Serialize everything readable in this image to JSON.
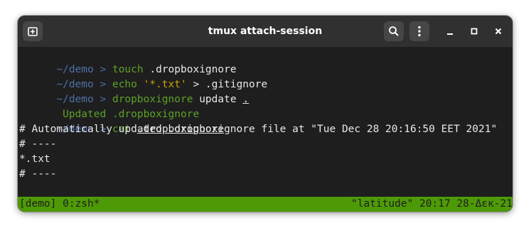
{
  "window": {
    "title": "tmux attach-session"
  },
  "icons": {
    "new_tab": "new-tab-icon",
    "search": "search-icon",
    "menu": "kebab-menu-icon",
    "minimize": "minimize-icon",
    "maximize": "maximize-icon",
    "close": "close-icon"
  },
  "colors": {
    "prompt": "#4e6fa8",
    "command": "#5da126",
    "string": "#c6a300",
    "status_bar": "#4e9a06",
    "background": "#1e1e1e"
  },
  "terminal": {
    "prompt": "~/demo > ",
    "lines": [
      {
        "cmd": "touch",
        "args": " .dropboxignore"
      },
      {
        "cmd": "echo",
        "str": " '*.txt'",
        "args": " > .gitignore"
      },
      {
        "cmd": "dropboxignore",
        "args": " update ",
        "underlined": "."
      },
      {
        "output_green": " Updated .dropboxignore"
      },
      {
        "cmd": "cat",
        "args": " ",
        "underlined": ".dropboxignore"
      }
    ],
    "output": [
      "# Automatically updated .dropboxignore file at \"Tue Dec 28 20:16:50 EET 2021\"",
      "# ----",
      "*.txt",
      "# ----"
    ]
  },
  "status": {
    "left": "[demo] 0:zsh*",
    "right": "\"latitude\" 20:17 28-Δεκ-21"
  }
}
